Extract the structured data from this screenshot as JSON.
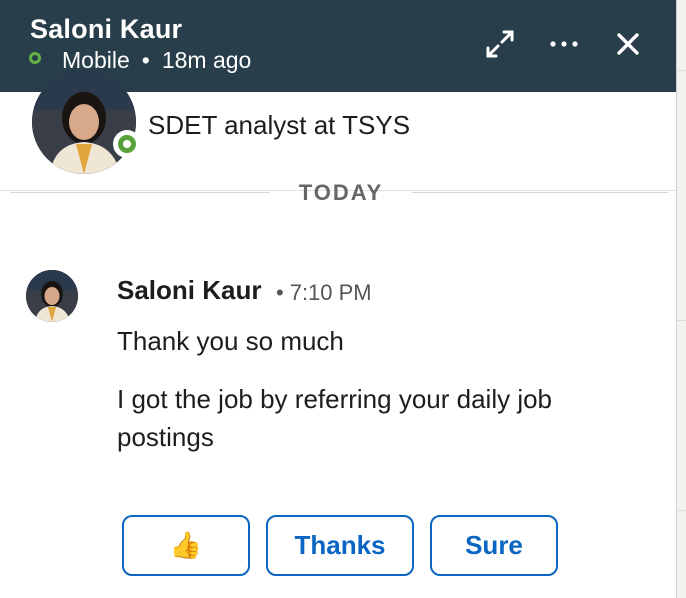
{
  "header": {
    "contact_name": "Saloni Kaur",
    "device": "Mobile",
    "separator": "•",
    "last_active": "18m ago",
    "presence_color": "#64b245",
    "icons": [
      "presence-ring-icon",
      "expand-icon",
      "more-icon",
      "close-icon"
    ]
  },
  "profile": {
    "headline": "SDET analyst at TSYS"
  },
  "divider": {
    "label": "TODAY"
  },
  "message": {
    "sender": "Saloni Kaur",
    "separator": "•",
    "time": "7:10 PM",
    "lines": [
      "Thank you so much",
      "I got the job by referring your daily job postings"
    ]
  },
  "quick_replies": [
    {
      "label": "👍"
    },
    {
      "label": "Thanks"
    },
    {
      "label": "Sure"
    }
  ],
  "colors": {
    "header_bg": "#283e4a",
    "accent": "#0a66c2",
    "online": "#57a33a"
  }
}
